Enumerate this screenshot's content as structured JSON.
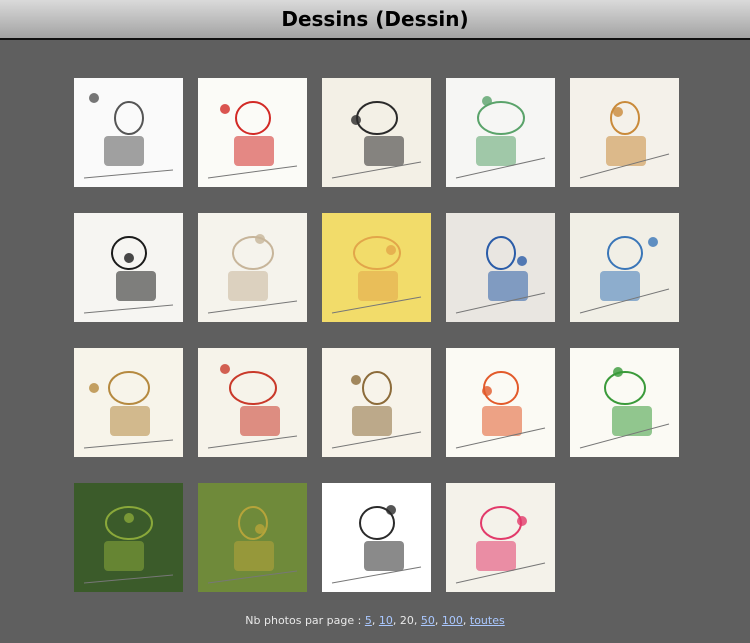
{
  "page": {
    "title": "Dessins (Dessin)"
  },
  "gallery": {
    "thumbnails": [
      {
        "name": "thumbnail-pencil-sketches",
        "bg": "#fafafa",
        "accent": "#555555"
      },
      {
        "name": "thumbnail-red-truck",
        "bg": "#fbfbf7",
        "accent": "#d22a26"
      },
      {
        "name": "thumbnail-climber-wall",
        "bg": "#f3f0e6",
        "accent": "#2a2a2a"
      },
      {
        "name": "thumbnail-photographers",
        "bg": "#f6f6f4",
        "accent": "#5aa36a"
      },
      {
        "name": "thumbnail-climbing-board",
        "bg": "#f4f1ea",
        "accent": "#c98a3a"
      },
      {
        "name": "thumbnail-glasses-portrait",
        "bg": "#f6f5f2",
        "accent": "#1b1b1b"
      },
      {
        "name": "thumbnail-bouldering",
        "bg": "#f5f3ec",
        "accent": "#c7b59a"
      },
      {
        "name": "thumbnail-yellow-portrait",
        "bg": "#f2dc6a",
        "accent": "#e2a64a"
      },
      {
        "name": "thumbnail-climbing-cave",
        "bg": "#e9e6e1",
        "accent": "#2a5ca8"
      },
      {
        "name": "thumbnail-men-talking",
        "bg": "#f1efe6",
        "accent": "#3a76b8"
      },
      {
        "name": "thumbnail-hanging-ropes",
        "bg": "#f7f4ea",
        "accent": "#b5893f"
      },
      {
        "name": "thumbnail-cafe-couple",
        "bg": "#f6f3ea",
        "accent": "#c9392a"
      },
      {
        "name": "thumbnail-cafe-men",
        "bg": "#f7f3ea",
        "accent": "#8c6b3a"
      },
      {
        "name": "thumbnail-sean-doll",
        "bg": "#fbfaf4",
        "accent": "#e25a2a"
      },
      {
        "name": "thumbnail-ribbon-man",
        "bg": "#fbfaf4",
        "accent": "#3a9a3a"
      },
      {
        "name": "thumbnail-forest",
        "bg": "#3b5b2a",
        "accent": "#8aa83a"
      },
      {
        "name": "thumbnail-green-wall",
        "bg": "#6f8a3a",
        "accent": "#b6a43a"
      },
      {
        "name": "thumbnail-stove",
        "bg": "#ffffff",
        "accent": "#2a2a2a"
      },
      {
        "name": "thumbnail-rope-climber",
        "bg": "#f4f2ea",
        "accent": "#e23a6a"
      }
    ]
  },
  "pagination": {
    "label": "Nb photos par page :",
    "options": [
      "5",
      "10",
      "20",
      "50",
      "100",
      "toutes"
    ],
    "current": "20",
    "separator": ","
  }
}
